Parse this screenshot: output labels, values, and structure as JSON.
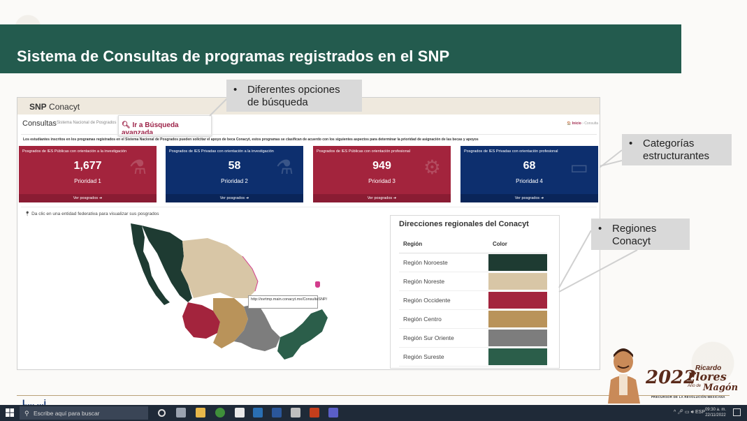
{
  "slide": {
    "title": "Sistema de Consultas de programas registrados en el SNP",
    "bottom_partial_text": "L... ...i"
  },
  "snp": {
    "brand_bold": "SNP",
    "brand_light": "Conacyt",
    "page_title": "Consultas",
    "page_subtitle": "Sistema Nacional de Posgrados",
    "breadcrumb_home": "Inicio",
    "breadcrumb_current": "Consulta",
    "search_button": "Ir a Búsqueda avanzada",
    "description": "Los estudiantes inscritos en los programas registrados en el Sistema Nacional de Posgrados pueden solicitar el apoyo de beca Conacyt, estos programas se clasifican de acuerdo con los siguientes aspectos para determinar la prioridad de asignación de las becas y apoyos",
    "cards": [
      {
        "title": "Posgrados de IES Públicas con orientación a la investigación",
        "count": "1,677",
        "priority": "Prioridad 1",
        "link": "Ver posgrados ➔",
        "color": "#a3243d",
        "icon": "flask-icon"
      },
      {
        "title": "Posgrados de IES Privadas con orientación a la investigación",
        "count": "58",
        "priority": "Prioridad 2",
        "link": "Ver posgrados ➔",
        "color": "#0d2f6e",
        "icon": "flask-icon"
      },
      {
        "title": "Posgrados de IES Públicas con orientación profesional",
        "count": "949",
        "priority": "Prioridad 3",
        "link": "Ver posgrados ➔",
        "color": "#a3243d",
        "icon": "gears-icon"
      },
      {
        "title": "Posgrados de IES Privadas con orientación profesional",
        "count": "68",
        "priority": "Prioridad 4",
        "link": "Ver posgrados ➔",
        "color": "#0d2f6e",
        "icon": "laptop-icon"
      }
    ],
    "map_hint": "Da clic en una entidad federativa para visualizar sus posgrados",
    "tooltip_url": "http://svrtmp.main.conacyt.mx/ConsultaSNP/",
    "regions_title": "Direcciones regionales del Conacyt",
    "regions_headers": {
      "region": "Región",
      "color": "Color"
    },
    "regions": [
      {
        "name": "Región Noroeste",
        "color": "#1e3b32"
      },
      {
        "name": "Región Noreste",
        "color": "#d8c6a6"
      },
      {
        "name": "Región Occidente",
        "color": "#a3243d"
      },
      {
        "name": "Región Centro",
        "color": "#b9935a"
      },
      {
        "name": "Región Sur Oriente",
        "color": "#7d7d7d"
      },
      {
        "name": "Región Sureste",
        "color": "#2b5e4a"
      }
    ]
  },
  "callouts": {
    "options": {
      "line1": "Diferentes opciones",
      "line2": "de búsqueda"
    },
    "categories": {
      "line1": "Categorías",
      "line2": "estructurantes"
    },
    "regions": {
      "line1": "Regiones",
      "line2": "Conacyt"
    }
  },
  "logo": {
    "year": "2022",
    "name_first": "Ricardo",
    "name_last1": "Flores",
    "name_last2": "Magón",
    "year_label": "Año de",
    "subtitle": "PRECURSOR DE LA REVOLUCIÓN MEXICANA"
  },
  "taskbar": {
    "search_placeholder": "Escribe aquí para buscar",
    "language": "ESP",
    "time": "09:30 a. m.",
    "date": "22/11/2022"
  }
}
